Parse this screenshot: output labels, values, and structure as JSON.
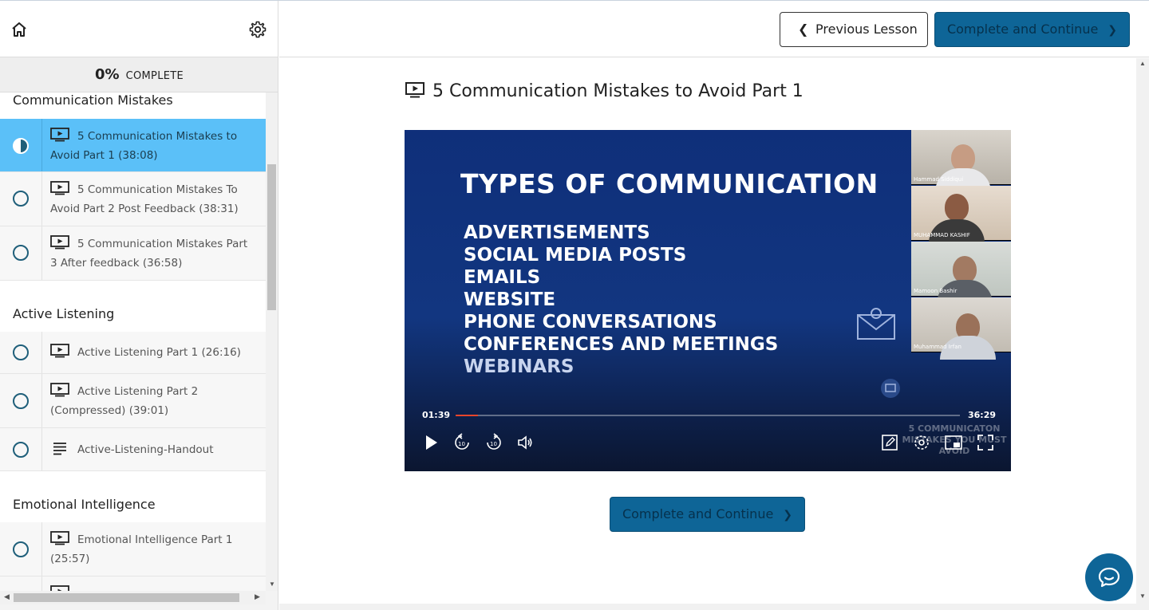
{
  "sidebar": {
    "progress_percent": "0%",
    "progress_label": "COMPLETE",
    "sections": [
      {
        "title": "Communication Mistakes",
        "lessons": [
          {
            "label": "5 Communication Mistakes to Avoid Part 1 (38:08)",
            "type": "video",
            "status": "in-progress"
          },
          {
            "label": "5 Communication Mistakes To Avoid Part 2 Post Feedback (38:31)",
            "type": "video",
            "status": "incomplete"
          },
          {
            "label": "5 Communication Mistakes Part 3 After feedback (36:58)",
            "type": "video",
            "status": "incomplete"
          }
        ]
      },
      {
        "title": "Active Listening",
        "lessons": [
          {
            "label": "Active Listening Part 1 (26:16)",
            "type": "video",
            "status": "incomplete"
          },
          {
            "label": "Active Listening Part 2 (Compressed) (39:01)",
            "type": "video",
            "status": "incomplete"
          },
          {
            "label": "Active-Listening-Handout",
            "type": "text",
            "status": "incomplete"
          }
        ]
      },
      {
        "title": "Emotional Intelligence",
        "lessons": [
          {
            "label": "Emotional Intelligence Part 1 (25:57)",
            "type": "video",
            "status": "incomplete"
          }
        ]
      }
    ]
  },
  "header": {
    "prev_label": "Previous Lesson",
    "complete_label": "Complete and Continue"
  },
  "lesson": {
    "title": "5 Communication Mistakes to Avoid Part 1"
  },
  "video": {
    "slide_title": "TYPES OF COMMUNICATION",
    "slide_items": [
      "ADVERTISEMENTS",
      "SOCIAL MEDIA POSTS",
      "EMAILS",
      "WEBSITE",
      "PHONE CONVERSATIONS",
      "CONFERENCES AND MEETINGS",
      "WEBINARS"
    ],
    "participants": [
      "Hammad Siddiqui",
      "MUHAMMAD KASHIF",
      "Mamoon Bashir",
      "Muhammad Irfan"
    ],
    "watermark": "5 COMMUNICATON MISTAKES YOU MUST AVOID",
    "current_time": "01:39",
    "duration": "36:29",
    "progress_fraction": 0.045
  },
  "colors": {
    "accent": "#0e6597",
    "active_lesson": "#5bc0f8",
    "progress_fill": "#e8452b"
  }
}
